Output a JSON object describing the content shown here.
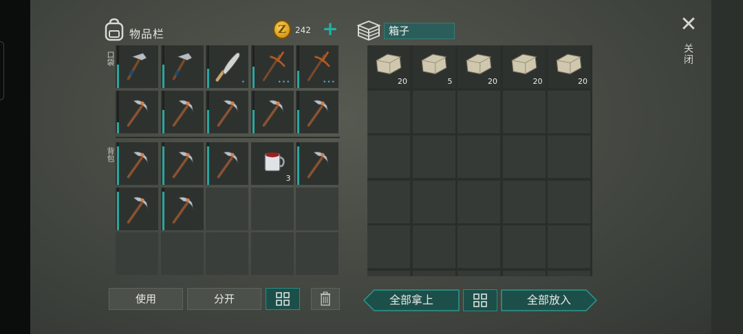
{
  "inventory": {
    "title": "物品栏",
    "coins": "242",
    "coin_symbol": "Z",
    "add_label": "+",
    "pocket_label": "口袋",
    "backpack_label": "背包"
  },
  "container": {
    "name": "箱子"
  },
  "close": {
    "icon": "close-icon",
    "label": "关闭"
  },
  "pocket_slots": [
    {
      "item": "hammer",
      "durability": 0.55,
      "count": "",
      "dots": ""
    },
    {
      "item": "hammer",
      "durability": 0.55,
      "count": "",
      "dots": ""
    },
    {
      "item": "machete",
      "durability": 0.45,
      "count": "",
      "dots": "•"
    },
    {
      "item": "pickaxe-rusty",
      "durability": 0.5,
      "count": "",
      "dots": "•••"
    },
    {
      "item": "pickaxe-rusty",
      "durability": 0.4,
      "count": "",
      "dots": "•••"
    },
    {
      "item": "pickaxe",
      "durability": 0.25,
      "count": "",
      "dots": ""
    },
    {
      "item": "pickaxe",
      "durability": 0.55,
      "count": "",
      "dots": ""
    },
    {
      "item": "pickaxe",
      "durability": 0.55,
      "count": "",
      "dots": ""
    },
    {
      "item": "pickaxe",
      "durability": 0.55,
      "count": "",
      "dots": ""
    },
    {
      "item": "pickaxe",
      "durability": 0.55,
      "count": "",
      "dots": ""
    }
  ],
  "backpack_slots": [
    {
      "item": "pickaxe",
      "durability": 0.9,
      "count": "",
      "dots": ""
    },
    {
      "item": "pickaxe",
      "durability": 0.9,
      "count": "",
      "dots": ""
    },
    {
      "item": "pickaxe",
      "durability": 0.9,
      "count": "",
      "dots": ""
    },
    {
      "item": "cup",
      "durability": 0,
      "count": "3",
      "dots": ""
    },
    {
      "item": "pickaxe",
      "durability": 0.9,
      "count": "",
      "dots": ""
    },
    {
      "item": "pickaxe",
      "durability": 0.9,
      "count": "",
      "dots": ""
    },
    {
      "item": "pickaxe",
      "durability": 0.9,
      "count": "",
      "dots": ""
    },
    {
      "item": "",
      "durability": 0,
      "count": "",
      "dots": ""
    },
    {
      "item": "",
      "durability": 0,
      "count": "",
      "dots": ""
    },
    {
      "item": "",
      "durability": 0,
      "count": "",
      "dots": ""
    },
    {
      "item": "",
      "durability": 0,
      "count": "",
      "dots": ""
    },
    {
      "item": "",
      "durability": 0,
      "count": "",
      "dots": ""
    },
    {
      "item": "",
      "durability": 0,
      "count": "",
      "dots": ""
    },
    {
      "item": "",
      "durability": 0,
      "count": "",
      "dots": ""
    },
    {
      "item": "",
      "durability": 0,
      "count": "",
      "dots": ""
    }
  ],
  "box_slots": [
    {
      "item": "stone",
      "count": "20"
    },
    {
      "item": "stone",
      "count": "5"
    },
    {
      "item": "stone",
      "count": "20"
    },
    {
      "item": "stone",
      "count": "20"
    },
    {
      "item": "stone",
      "count": "20"
    },
    {
      "item": "",
      "count": ""
    },
    {
      "item": "",
      "count": ""
    },
    {
      "item": "",
      "count": ""
    },
    {
      "item": "",
      "count": ""
    },
    {
      "item": "",
      "count": ""
    },
    {
      "item": "",
      "count": ""
    },
    {
      "item": "",
      "count": ""
    },
    {
      "item": "",
      "count": ""
    },
    {
      "item": "",
      "count": ""
    },
    {
      "item": "",
      "count": ""
    },
    {
      "item": "",
      "count": ""
    },
    {
      "item": "",
      "count": ""
    },
    {
      "item": "",
      "count": ""
    },
    {
      "item": "",
      "count": ""
    },
    {
      "item": "",
      "count": ""
    },
    {
      "item": "",
      "count": ""
    },
    {
      "item": "",
      "count": ""
    },
    {
      "item": "",
      "count": ""
    },
    {
      "item": "",
      "count": ""
    },
    {
      "item": "",
      "count": ""
    },
    {
      "item": "",
      "count": ""
    },
    {
      "item": "",
      "count": ""
    },
    {
      "item": "",
      "count": ""
    },
    {
      "item": "",
      "count": ""
    },
    {
      "item": "",
      "count": ""
    }
  ],
  "buttons": {
    "use": "使用",
    "split": "分开",
    "take_all": "全部拿上",
    "put_all": "全部放入"
  },
  "colors": {
    "accent": "#1fb3a6",
    "teal_button": "#1d4f4a",
    "durability": "#2aa6a0"
  }
}
